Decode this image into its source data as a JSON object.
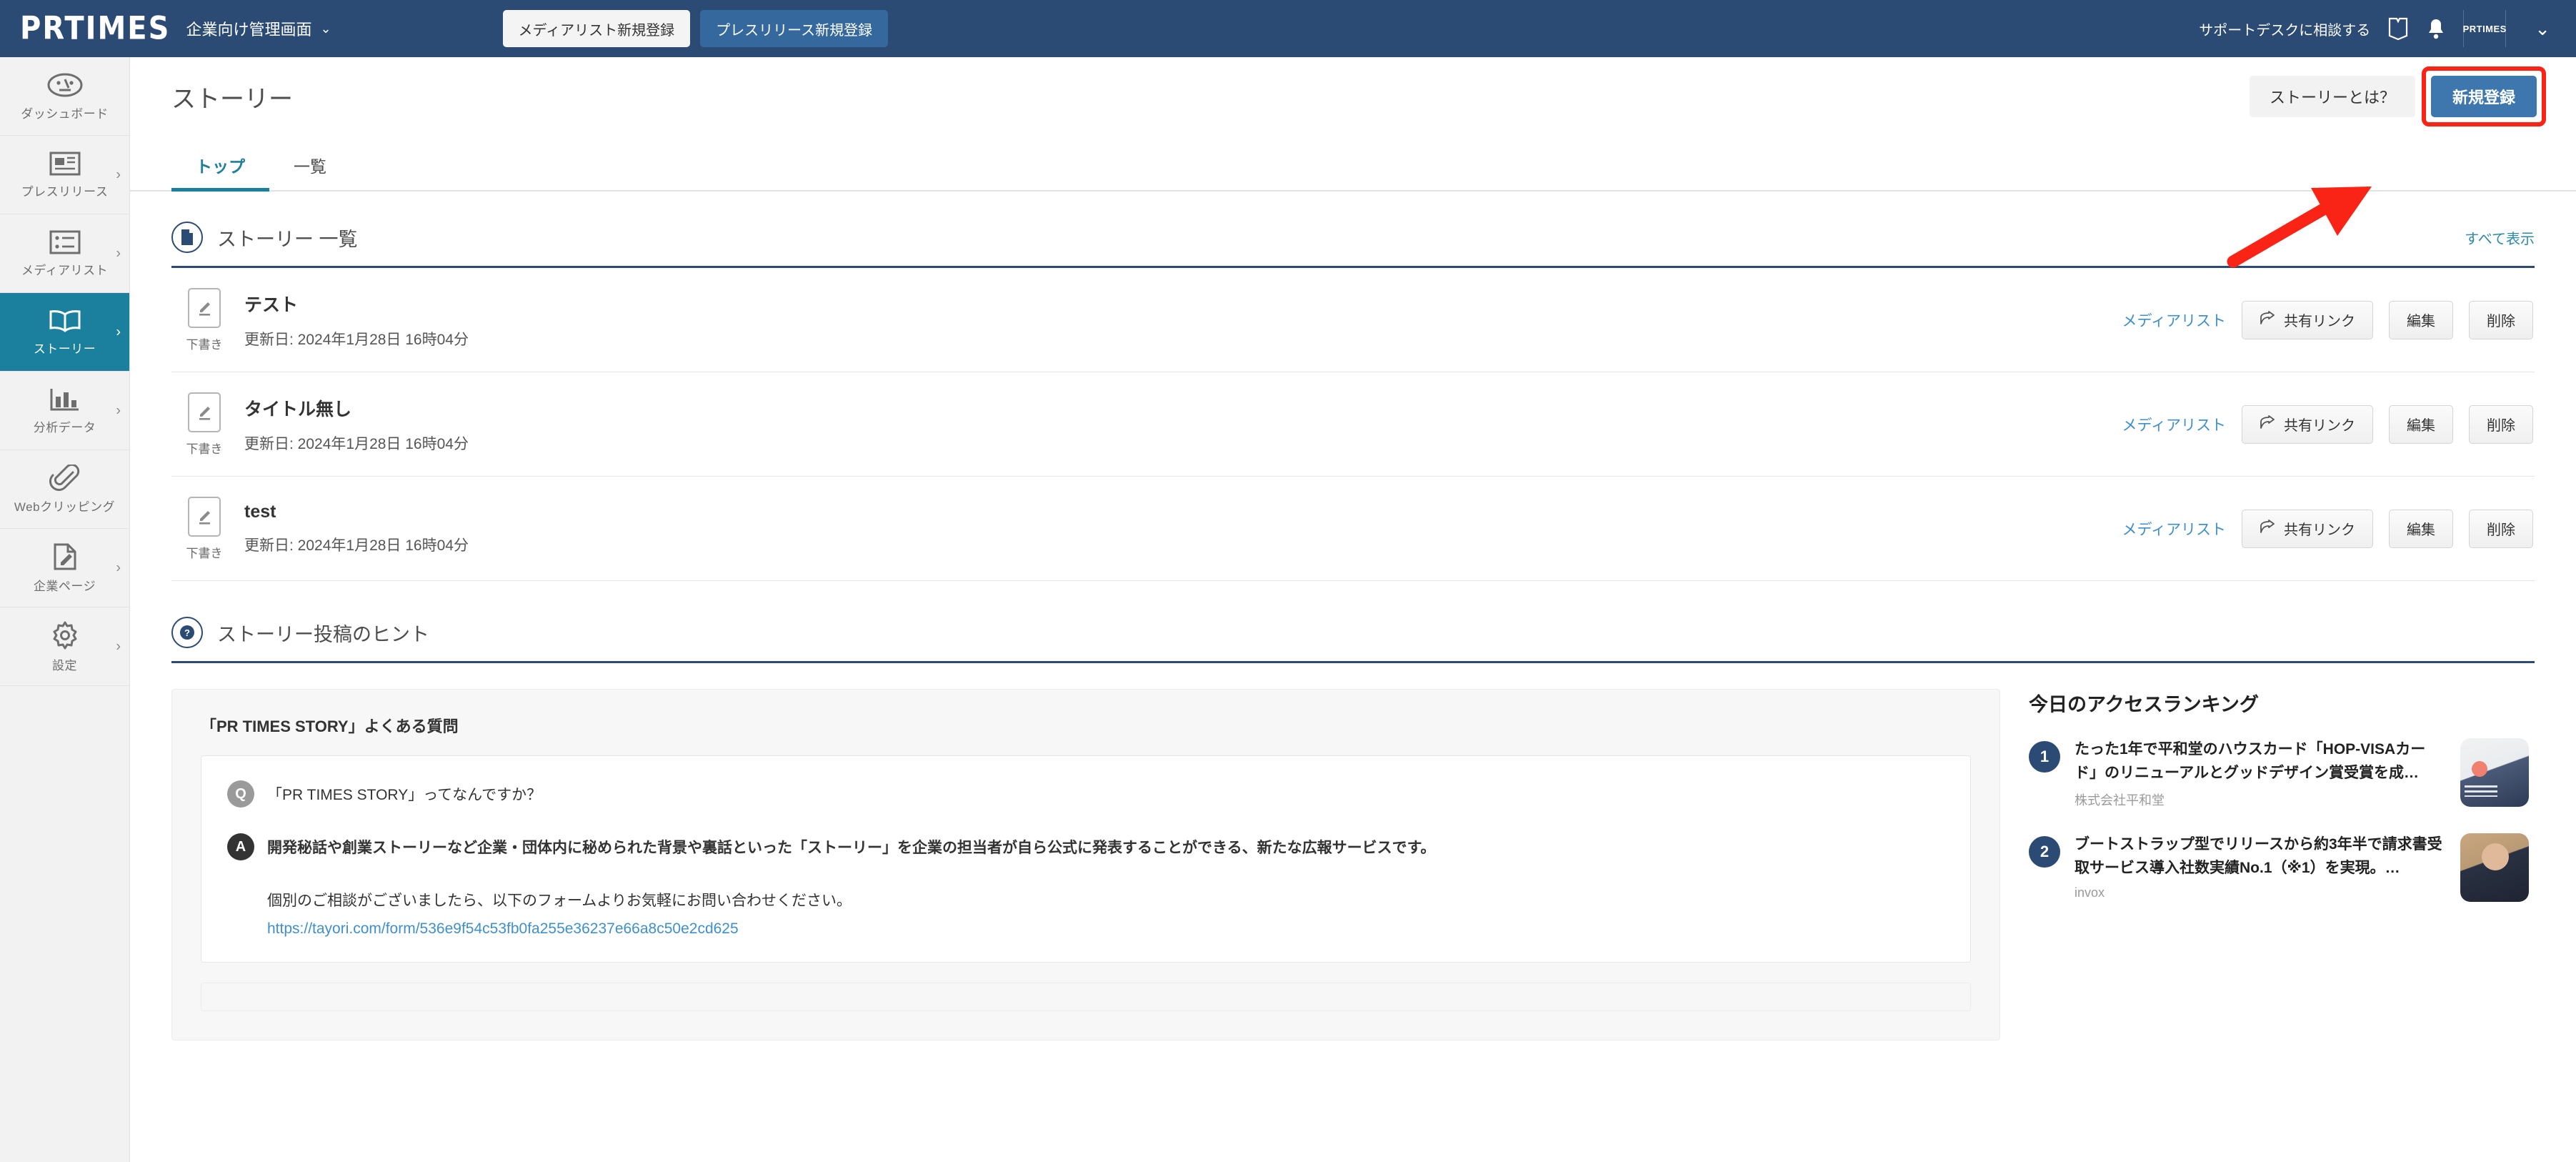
{
  "header": {
    "logo": "PRTIMES",
    "logo_subtitle": "企業向け管理画面",
    "caret": "⌄",
    "btn_medialist": "メディアリスト新規登録",
    "btn_pressrelease": "プレスリリース新規登録",
    "support_text": "サポートデスクに相談する",
    "manual_icon": "book-icon",
    "bell_icon": "bell-icon",
    "avatar_label": "PRTIMES",
    "right_caret": "⌄"
  },
  "sidebar": {
    "items": [
      {
        "label": "ダッシュボード",
        "icon": "dashboard-icon",
        "chevron": "",
        "active": false
      },
      {
        "label": "プレスリリース",
        "icon": "newspaper-icon",
        "chevron": "›",
        "active": false
      },
      {
        "label": "メディアリスト",
        "icon": "list-icon",
        "chevron": "›",
        "active": false
      },
      {
        "label": "ストーリー",
        "icon": "book-open-icon",
        "chevron": "›",
        "active": true
      },
      {
        "label": "分析データ",
        "icon": "bar-chart-icon",
        "chevron": "›",
        "active": false
      },
      {
        "label": "Webクリッピング",
        "icon": "paperclip-icon",
        "chevron": "",
        "active": false
      },
      {
        "label": "企業ページ",
        "icon": "document-edit-icon",
        "chevron": "›",
        "active": false
      },
      {
        "label": "設定",
        "icon": "gear-icon",
        "chevron": "›",
        "active": false
      }
    ]
  },
  "page": {
    "title": "ストーリー",
    "btn_what_is": "ストーリーとは？",
    "btn_new": "新規登録",
    "highlight_color": "#fa2416",
    "accent_color": "#1b7f9e"
  },
  "tabs": [
    {
      "label": "トップ",
      "active": true
    },
    {
      "label": "一覧",
      "active": false
    }
  ],
  "story_section": {
    "title": "ストーリー 一覧",
    "icon": "document-icon",
    "show_all": "すべて表示",
    "rows": [
      {
        "status": "下書き",
        "status_icon": "pencil-draft-icon",
        "title": "テスト",
        "date": "更新日: 2024年1月28日 16時04分",
        "medialist": "メディアリスト",
        "share": "共有リンク",
        "share_icon": "share-icon",
        "edit": "編集",
        "delete": "削除"
      },
      {
        "status": "下書き",
        "status_icon": "pencil-draft-icon",
        "title": "タイトル無し",
        "date": "更新日: 2024年1月28日 16時04分",
        "medialist": "メディアリスト",
        "share": "共有リンク",
        "share_icon": "share-icon",
        "edit": "編集",
        "delete": "削除"
      },
      {
        "status": "下書き",
        "status_icon": "pencil-draft-icon",
        "title": "test",
        "date": "更新日: 2024年1月28日 16時04分",
        "medialist": "メディアリスト",
        "share": "共有リンク",
        "share_icon": "share-icon",
        "edit": "編集",
        "delete": "削除"
      }
    ]
  },
  "hint_section": {
    "title": "ストーリー投稿のヒント",
    "icon": "question-circle-icon"
  },
  "faq": {
    "card_title": "「PR TIMES STORY」よくある質問",
    "q_badge": "Q",
    "a_badge": "A",
    "question": "「PR TIMES STORY」ってなんですか？",
    "answer": "開発秘話や創業ストーリーなど企業・団体内に秘められた背景や裏話といった「ストーリー」を企業の担当者が自ら公式に発表することができる、新たな広報サービスです。",
    "form_note": "個別のご相談がございましたら、以下のフォームよりお気軽にお問い合わせください。",
    "form_url": "https://tayori.com/form/536e9f54c53fb0fa255e36237e66a8c50e2cd625"
  },
  "ranking": {
    "title": "今日のアクセスランキング",
    "items": [
      {
        "rank": "1",
        "headline": "たった1年で平和堂のハウスカード「HOP-VISAカード」のリニューアルとグッドデザイン賞受賞を成…",
        "company": "株式会社平和堂",
        "thumb": "good-design-award-photo"
      },
      {
        "rank": "2",
        "headline": "ブートストラップ型でリリースから約3年半で請求書受取サービス導入社数実績No.1（※1）を実現。…",
        "company": "invox",
        "thumb": "portrait-photo"
      }
    ]
  }
}
